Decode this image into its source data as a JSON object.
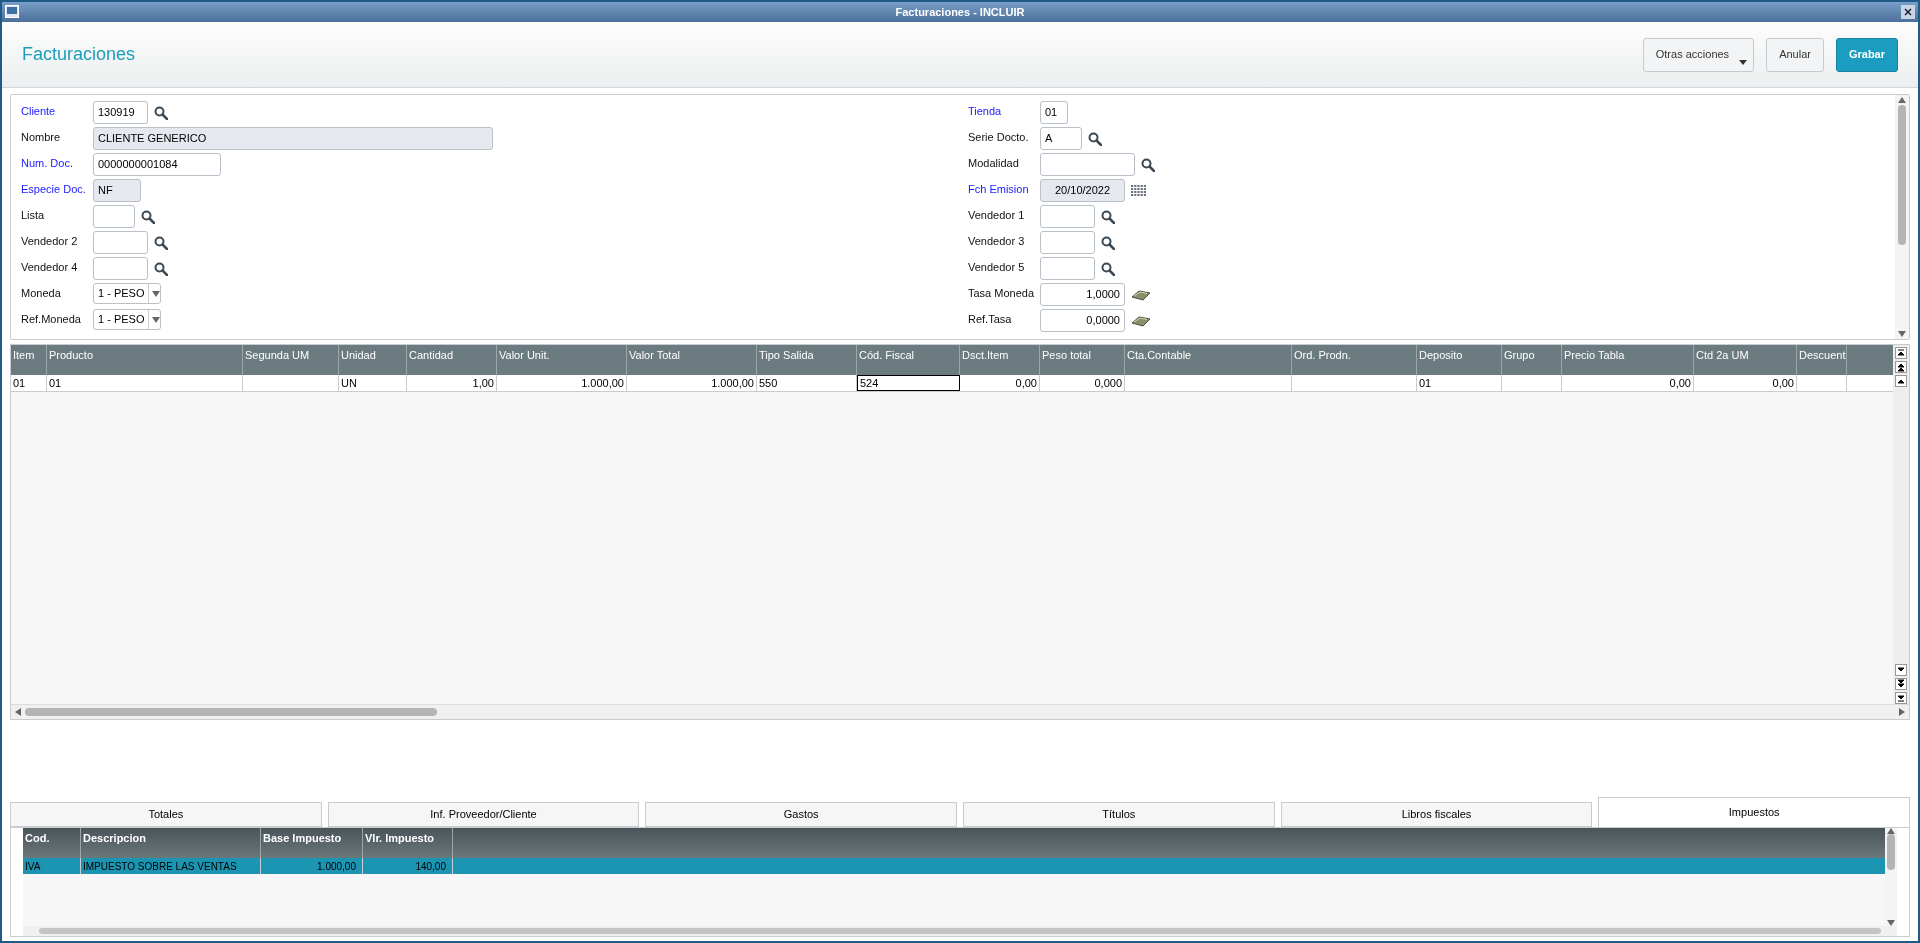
{
  "window": {
    "title": "Facturaciones - INCLUIR"
  },
  "header": {
    "title": "Facturaciones",
    "buttons": [
      {
        "label": "Otras acciones",
        "kind": "menu"
      },
      {
        "label": "Anular",
        "kind": "plain"
      },
      {
        "label": "Grabar",
        "kind": "primary"
      }
    ]
  },
  "form": {
    "left": [
      {
        "label": "Cliente",
        "value": "130919",
        "required": true,
        "readonly": false,
        "kind": "lookup"
      },
      {
        "label": "Nombre",
        "value": "CLIENTE GENERICO",
        "required": false,
        "readonly": true,
        "kind": "text"
      },
      {
        "label": "Num. Doc.",
        "value": "0000000001084",
        "required": true,
        "readonly": false,
        "kind": "text"
      },
      {
        "label": "Especie Doc.",
        "value": "NF",
        "required": true,
        "readonly": true,
        "kind": "text"
      },
      {
        "label": "Lista",
        "required": false,
        "readonly": false,
        "kind": "lookup"
      },
      {
        "label": "Vendedor 2",
        "required": false,
        "readonly": false,
        "kind": "lookup"
      },
      {
        "label": "Vendedor 4",
        "required": false,
        "readonly": false,
        "kind": "lookup"
      },
      {
        "label": "Moneda",
        "value": "1 - PESO",
        "required": false,
        "readonly": false,
        "kind": "select"
      },
      {
        "label": "Ref.Moneda",
        "value": "1 - PESO",
        "required": false,
        "readonly": false,
        "kind": "select"
      }
    ],
    "right": [
      {
        "label": "Tienda",
        "value": "01",
        "required": true,
        "readonly": false,
        "kind": "text"
      },
      {
        "label": "Serie Docto.",
        "value": "A",
        "required": false,
        "readonly": false,
        "kind": "lookup"
      },
      {
        "label": "Modalidad",
        "required": false,
        "readonly": false,
        "kind": "lookup"
      },
      {
        "label": "Fch Emision",
        "value": "20/10/2022",
        "required": true,
        "readonly": true,
        "kind": "date"
      },
      {
        "label": "Vendedor 1",
        "required": false,
        "readonly": false,
        "kind": "lookup"
      },
      {
        "label": "Vendedor 3",
        "required": false,
        "readonly": false,
        "kind": "lookup"
      },
      {
        "label": "Vendedor 5",
        "required": false,
        "readonly": false,
        "kind": "lookup"
      },
      {
        "label": "Tasa Moneda",
        "value": "1,0000",
        "required": false,
        "readonly": false,
        "kind": "money"
      },
      {
        "label": "Ref.Tasa",
        "value": "0,0000",
        "required": false,
        "readonly": false,
        "kind": "money"
      }
    ]
  },
  "grid": {
    "columns": [
      "Item",
      "Producto",
      "Segunda UM",
      "Unidad",
      "Cantidad",
      "Valor Unit.",
      "Valor Total",
      "Tipo Salida",
      "Cód. Fiscal",
      "Dsct.Item",
      "Peso total",
      "Cta.Contable",
      "Ord. Prodn.",
      "Deposito",
      "Grupo",
      "Precio Tabla",
      "Ctd 2a UM",
      "Descuent"
    ],
    "rows": [
      {
        "cells": [
          {
            "text": "01",
            "focused": false
          },
          {
            "text": "01",
            "focused": false
          },
          {
            "focused": false
          },
          {
            "text": "UN",
            "focused": false
          },
          {
            "text": "1,00",
            "focused": false
          },
          {
            "text": "1.000,00",
            "focused": false
          },
          {
            "text": "1.000,00",
            "focused": false
          },
          {
            "text": "550",
            "focused": false
          },
          {
            "text": "524",
            "focused": true
          },
          {
            "text": "0,00",
            "focused": false
          },
          {
            "text": "0,000",
            "focused": false
          },
          {
            "focused": false
          },
          {
            "focused": false
          },
          {
            "text": "01",
            "focused": false
          },
          {
            "focused": false
          },
          {
            "text": "0,00",
            "focused": false
          },
          {
            "text": "0,00",
            "focused": false
          },
          {
            "focused": false
          }
        ]
      }
    ]
  },
  "tabs": [
    {
      "label": "Totales",
      "selected": false
    },
    {
      "label": "Inf. Proveedor/Cliente",
      "selected": false
    },
    {
      "label": "Gastos",
      "selected": false
    },
    {
      "label": "Títulos",
      "selected": false
    },
    {
      "label": "Libros fiscales",
      "selected": false
    },
    {
      "label": "Impuestos",
      "selected": true
    }
  ],
  "taxes": {
    "columns": [
      "Cod.",
      "Descripcion",
      "Base Impuesto",
      "Vlr. Impuesto"
    ],
    "rows": [
      {
        "cells": [
          "IVA",
          "IMPUESTO SOBRE LAS VENTAS",
          "1.000,00",
          "140,00"
        ],
        "selected": true
      }
    ]
  }
}
